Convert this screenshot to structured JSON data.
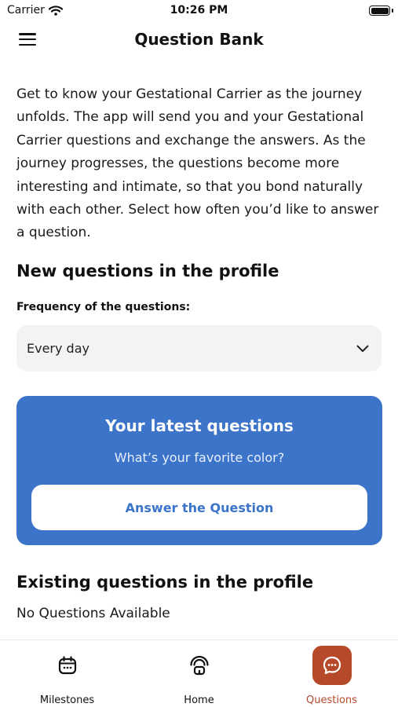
{
  "status_bar": {
    "carrier": "Carrier",
    "time": "10:26 PM"
  },
  "header": {
    "title": "Question Bank"
  },
  "intro_text": "Get to know your Gestational Carrier as the journey unfolds. The app will send you and your Gestational Carrier questions and exchange the answers. As the journey progresses, the questions become more interesting and intimate, so that you bond naturally with each other. Select how often you’d like to answer a question.",
  "new_questions": {
    "title": "New questions in the profile",
    "frequency_label": "Frequency of the questions:",
    "frequency_value": "Every day"
  },
  "latest_card": {
    "title": "Your latest questions",
    "question": "What’s your favorite color?",
    "button_label": "Answer the Question"
  },
  "existing_questions": {
    "title": "Existing questions in the profile",
    "empty_text": "No Questions Available"
  },
  "tab_bar": {
    "tabs": [
      {
        "label": "Milestones",
        "icon": "calendar-icon",
        "active": false
      },
      {
        "label": "Home",
        "icon": "home-signal-icon",
        "active": false
      },
      {
        "label": "Questions",
        "icon": "chat-bubble-icon",
        "active": true
      }
    ]
  },
  "colors": {
    "accent_blue": "#3b74c9",
    "active_tab": "#b5492a"
  }
}
